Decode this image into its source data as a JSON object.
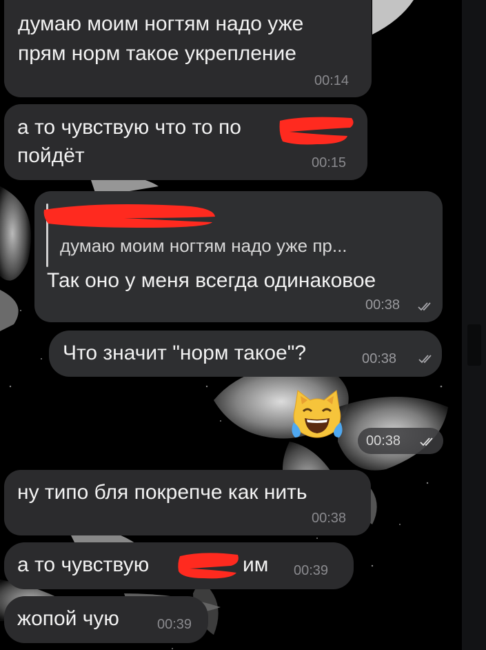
{
  "messages": [
    {
      "text_lines": [
        "думаю моим ногтям надо уже",
        "прям норм такое укрепление"
      ],
      "time": "00:14"
    },
    {
      "text_lines": [
        "а то чувствую что то по",
        "пойдёт"
      ],
      "time": "00:15"
    },
    {
      "reply_quote": "думаю моим ногтям надо уже пр...",
      "text": "Так оно у меня всегда одинаковое",
      "time": "00:38",
      "status": "read"
    },
    {
      "text": "Что значит \"норм такое\"?",
      "time": "00:38",
      "status": "read"
    },
    {
      "emoji": "😹",
      "time": "00:38",
      "status": "read"
    },
    {
      "text": "ну типо бля покрепче как нить",
      "time": "00:38"
    },
    {
      "text_before": "а то чувствую",
      "text_after": "им",
      "time": "00:39"
    },
    {
      "text": "жопой чую",
      "time": "00:39"
    }
  ],
  "colors": {
    "bubble": "#2b2b2d",
    "time": "#8a8a8e",
    "redaction": "#ff2a1f"
  },
  "icons": {
    "read_status": "double-check-icon",
    "emoji": "crying-laughing-cat-emoji"
  }
}
